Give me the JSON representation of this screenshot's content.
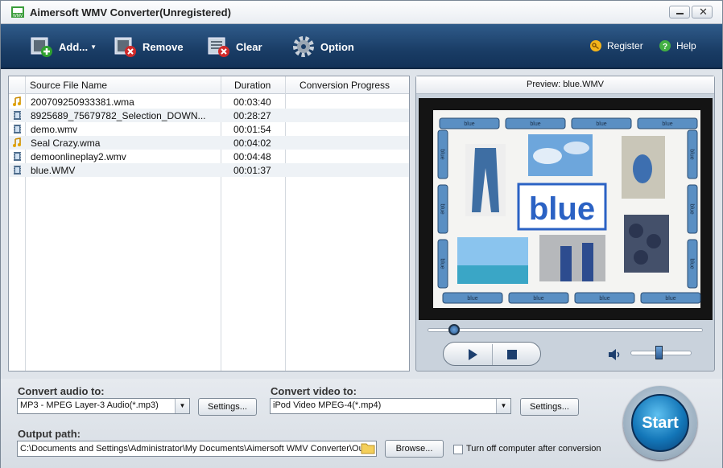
{
  "window": {
    "title": "Aimersoft WMV Converter(Unregistered)"
  },
  "toolbar": {
    "add_label": "Add...",
    "remove_label": "Remove",
    "clear_label": "Clear",
    "option_label": "Option",
    "register_label": "Register",
    "help_label": "Help"
  },
  "filelist": {
    "headers": {
      "name": "Source File Name",
      "duration": "Duration",
      "progress": "Conversion Progress"
    },
    "rows": [
      {
        "name": "200709250933381.wma",
        "duration": "00:03:40",
        "type": "audio-file-icon"
      },
      {
        "name": "8925689_75679782_Selection_DOWN...",
        "duration": "00:28:27",
        "type": "video-file-icon"
      },
      {
        "name": "demo.wmv",
        "duration": "00:01:54",
        "type": "video-file-icon"
      },
      {
        "name": "Seal Crazy.wma",
        "duration": "00:04:02",
        "type": "audio-file-icon"
      },
      {
        "name": "demoonlineplay2.wmv",
        "duration": "00:04:48",
        "type": "video-file-icon"
      },
      {
        "name": "blue.WMV",
        "duration": "00:01:37",
        "type": "video-file-icon"
      }
    ]
  },
  "preview": {
    "title": "Preview: blue.WMV",
    "frame_word": "blue",
    "crayon_label": "blue",
    "seek_position": 0.07,
    "volume_level": 0.5
  },
  "bottom": {
    "audio_label": "Convert audio to:",
    "audio_value": "MP3 - MPEG Layer-3 Audio(*.mp3)",
    "audio_settings": "Settings...",
    "video_label": "Convert video to:",
    "video_value": "iPod Video MPEG-4(*.mp4)",
    "video_settings": "Settings...",
    "output_label": "Output path:",
    "output_value": "C:\\Documents and Settings\\Administrator\\My Documents\\Aimersoft WMV Converter\\Ou",
    "browse_label": "Browse...",
    "shutdown_label": "Turn off computer after conversion",
    "start_label": "Start"
  },
  "colors": {
    "toolbar": "#1a3d66",
    "start": "#1376b8",
    "crayon": "#5a8fc3"
  }
}
